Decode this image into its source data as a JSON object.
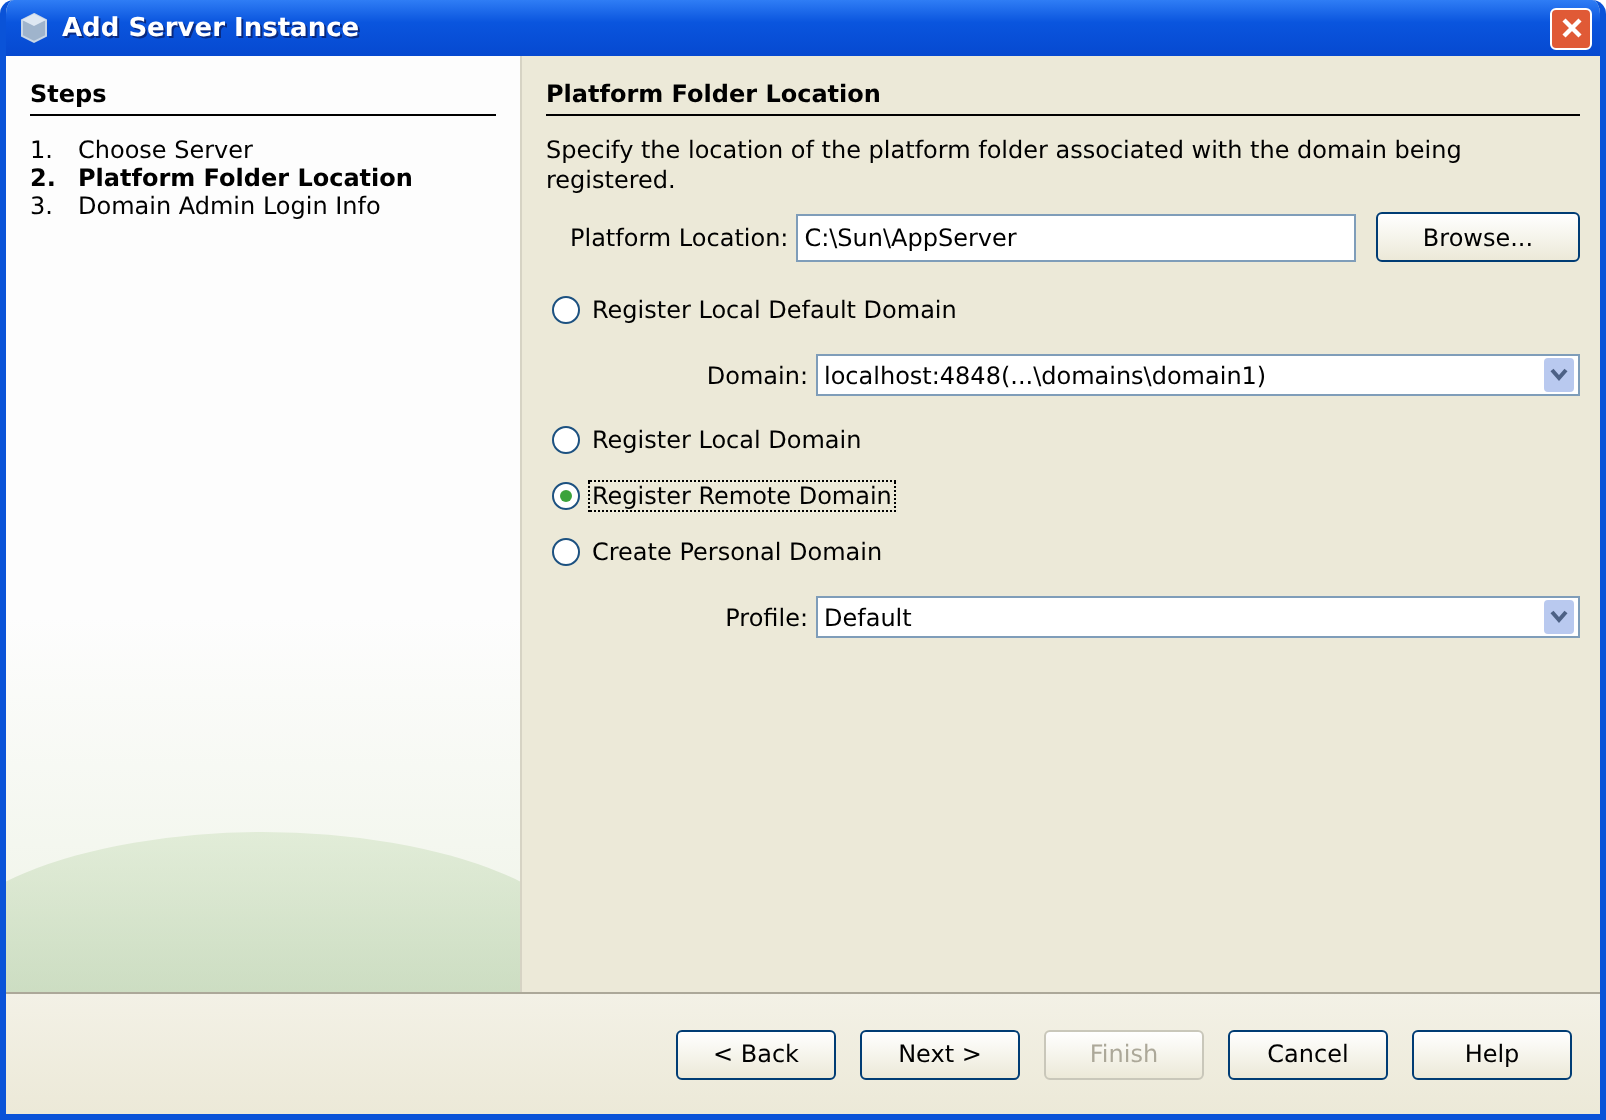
{
  "window": {
    "title": "Add Server Instance"
  },
  "steps": {
    "heading": "Steps",
    "items": [
      {
        "number": "1.",
        "label": "Choose Server",
        "selected": false
      },
      {
        "number": "2.",
        "label": "Platform Folder Location",
        "selected": true
      },
      {
        "number": "3.",
        "label": "Domain Admin Login Info",
        "selected": false
      }
    ]
  },
  "panel": {
    "heading": "Platform Folder Location",
    "description": "Specify the location of the platform folder associated with the domain being registered.",
    "location": {
      "label": "Platform Location:",
      "value": "C:\\Sun\\AppServer",
      "button": "Browse..."
    },
    "options": [
      {
        "label": "Register Local Default Domain",
        "selected": false,
        "focused": false,
        "field": {
          "label": "Domain:",
          "value": "localhost:4848(...\\domains\\domain1)"
        }
      },
      {
        "label": "Register Local Domain",
        "selected": false,
        "focused": false
      },
      {
        "label": "Register Remote Domain",
        "selected": true,
        "focused": true
      },
      {
        "label": "Create Personal Domain",
        "selected": false,
        "focused": false,
        "field": {
          "label": "Profile:",
          "value": "Default"
        }
      }
    ]
  },
  "buttons": [
    {
      "label": "< Back",
      "disabled": false
    },
    {
      "label": "Next >",
      "disabled": false
    },
    {
      "label": "Finish",
      "disabled": true
    },
    {
      "label": "Cancel",
      "disabled": false
    },
    {
      "label": "Help",
      "disabled": false
    }
  ]
}
